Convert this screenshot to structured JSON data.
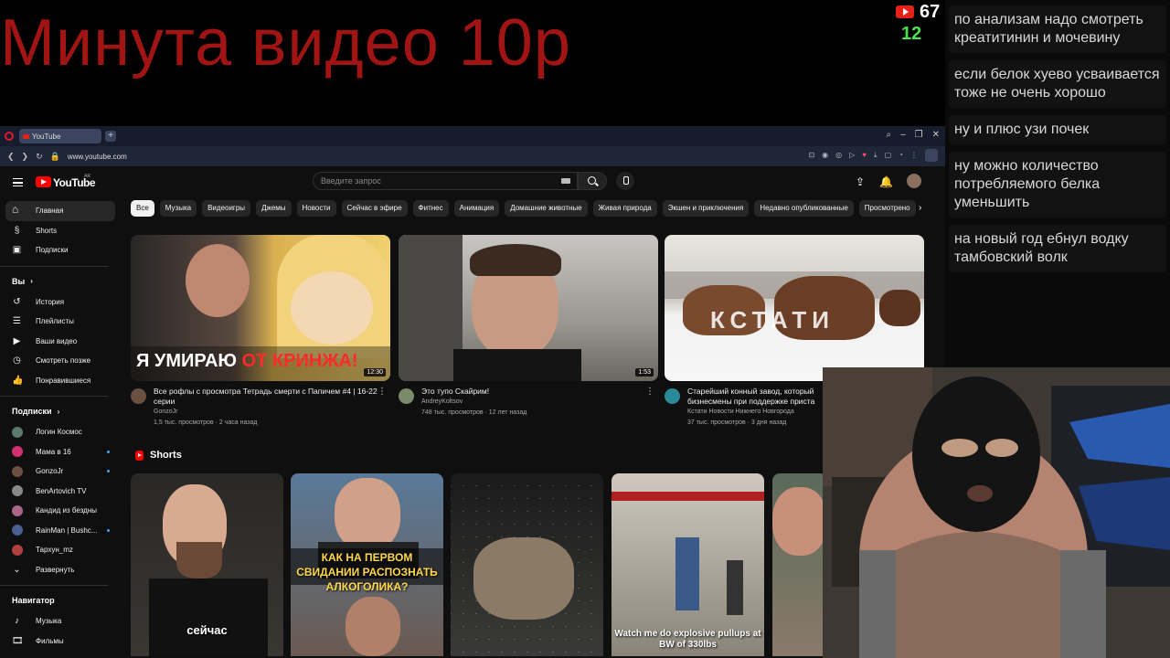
{
  "overlay": {
    "title": "Минута видео 10р",
    "views_count": "67",
    "other_count": "12"
  },
  "chat": {
    "messages": [
      "по анализам надо смотреть креатитинин и мочевину",
      "если белок хуево усваивается тоже не очень хорошо",
      "ну и плюс узи почек",
      "ну можно количество потребляемого белка уменьшить",
      "на новый год ебнул водку тамбовский волк"
    ]
  },
  "browser": {
    "tab_title": "YouTube",
    "url": "www.youtube.com"
  },
  "youtube": {
    "logo_text": "YouTube",
    "country": "AR",
    "search_placeholder": "Введите запрос",
    "sidebar": {
      "main": [
        "Главная",
        "Shorts",
        "Подписки"
      ],
      "you_header": "Вы",
      "you_items": [
        "История",
        "Плейлисты",
        "Ваши видео",
        "Смотреть позже",
        "Понравившиеся"
      ],
      "subs_header": "Подписки",
      "subs": [
        {
          "name": "Логин Космос",
          "color": "#5a7a6a",
          "live": false
        },
        {
          "name": "Мама в 16",
          "color": "#d03070",
          "live": true
        },
        {
          "name": "GonzoJr",
          "color": "#6a5040",
          "live": true
        },
        {
          "name": "BenArtovich TV",
          "color": "#888888",
          "live": false
        },
        {
          "name": "Кандид из бездны",
          "color": "#aa6688",
          "live": false
        },
        {
          "name": "RainMan | Bushc...",
          "color": "#4a6090",
          "live": true
        },
        {
          "name": "Тархун_mz",
          "color": "#b04040",
          "live": false
        }
      ],
      "expand": "Развернуть",
      "nav_header": "Навигатор",
      "nav_items": [
        "Музыка",
        "Фильмы"
      ]
    },
    "chips": [
      "Все",
      "Музыка",
      "Видеоигры",
      "Джемы",
      "Новости",
      "Сейчас в эфире",
      "Фитнес",
      "Анимация",
      "Домашние животные",
      "Живая природа",
      "Экшен и приключения",
      "Недавно опубликованные",
      "Просмотрено"
    ],
    "videos": [
      {
        "title": "Все рофлы с просмотра Тетрадь смерти с Папичем #4 | 16-22 серии",
        "channel": "GonzoJr",
        "stats": "1,5 тыс. просмотров · 2 часа назад",
        "duration": "12:30",
        "thumb_caption_white": "Я УМИРАЮ",
        "thumb_caption_red": "ОТ КРИНЖА!"
      },
      {
        "title": "Это тупо Скайрим!",
        "channel": "AndreyKoltsov",
        "stats": "748 тыс. просмотров · 12 лет назад",
        "duration": "1:53"
      },
      {
        "title": "Старейший конный завод, который бизнесмены при поддержке приста",
        "channel": "Кстати Новости Нижнего Новгорода",
        "stats": "37 тыс. просмотров · 3 дня назад",
        "thumb_caption": "КСТАТИ"
      }
    ],
    "shorts_title": "Shorts",
    "shorts": [
      {
        "caption": "сейчас"
      },
      {
        "caption": "КАК НА ПЕРВОМ СВИДАНИИ РАСПОЗНАТЬ АЛКОГОЛИКА?"
      },
      {
        "caption": ""
      },
      {
        "caption": "Watch me do explosive pullups at BW of 330lbs"
      },
      {
        "caption": ""
      }
    ]
  }
}
